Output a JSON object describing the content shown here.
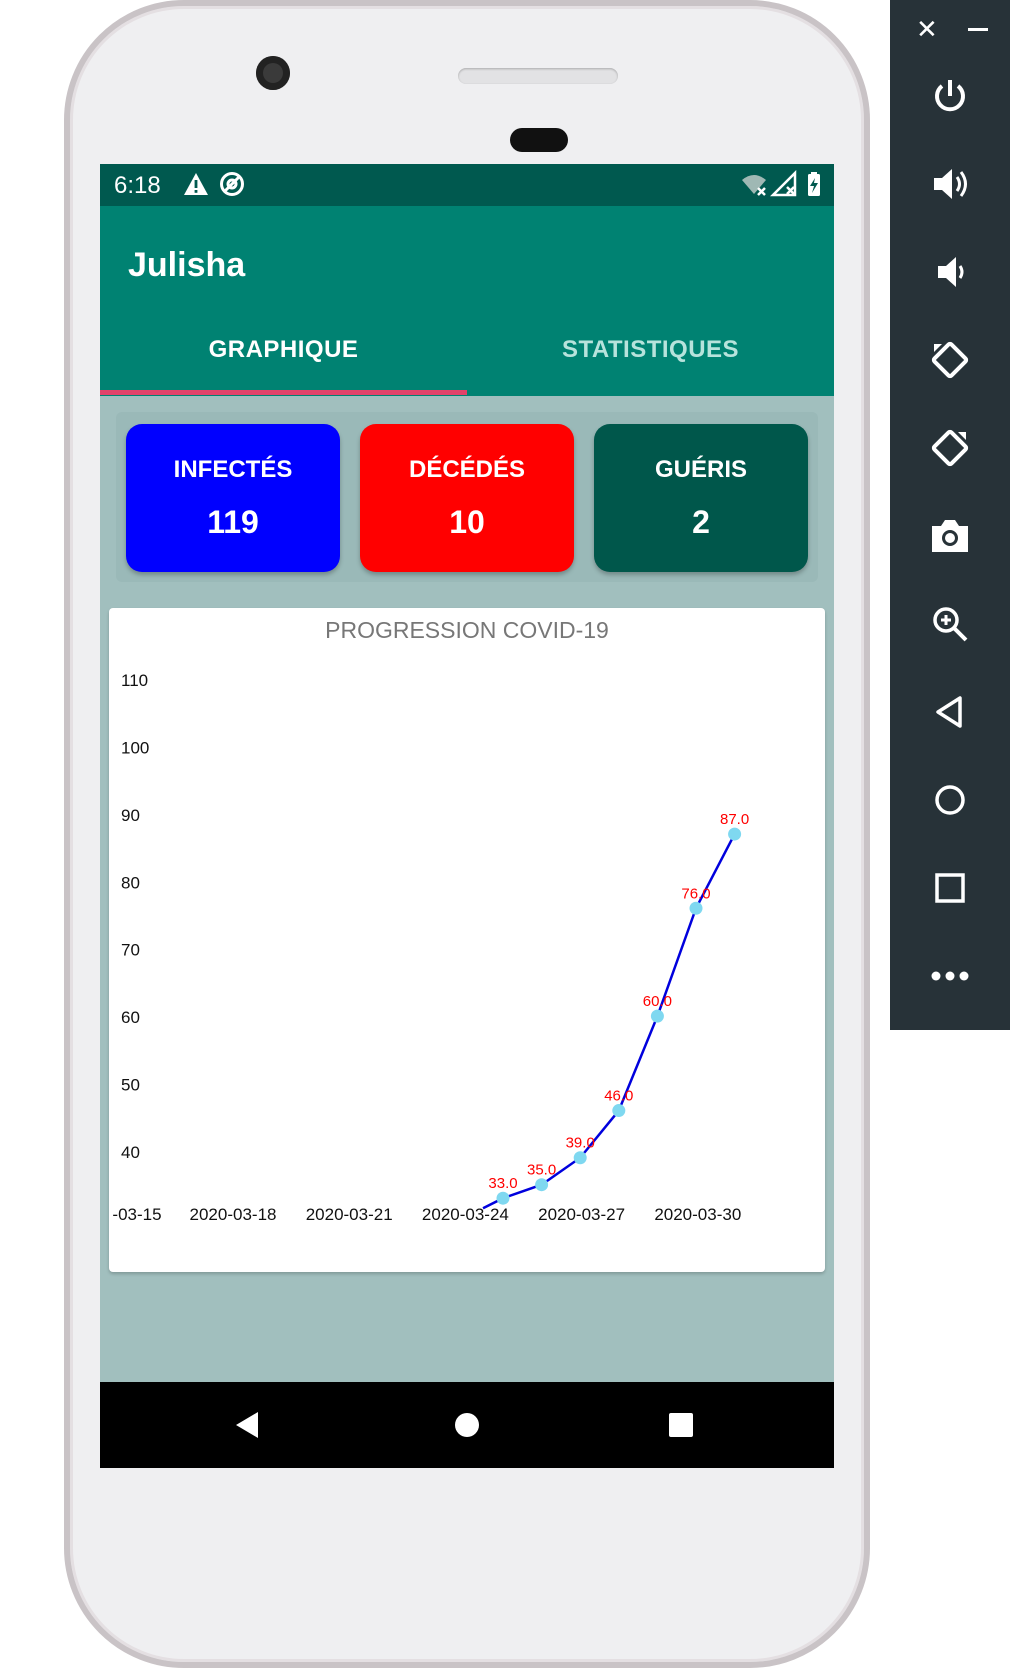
{
  "status_bar": {
    "time": "6:18",
    "left_icons": [
      "warning-icon",
      "accessibility-icon"
    ],
    "right_icons": [
      "wifi-off-icon",
      "signal-off-icon",
      "battery-charging-icon"
    ]
  },
  "app": {
    "title": "Julisha"
  },
  "tabs": [
    {
      "label": "GRAPHIQUE",
      "active": true
    },
    {
      "label": "STATISTIQUES",
      "active": false
    }
  ],
  "colors": {
    "statusbar": "#00594f",
    "appbar": "#008272",
    "tab_indicator": "#e2436a",
    "content_bg": "#a1bfbe",
    "infected": "#0000ff",
    "deaths": "#ff0000",
    "recovered": "#00574b",
    "chart_line": "#0000dd",
    "chart_point": "#7fd8f0",
    "chart_value_label": "#ff0000"
  },
  "stats": {
    "infected": {
      "label": "INFECTÉS",
      "value": "119"
    },
    "deaths": {
      "label": "DÉCÉDÉS",
      "value": "10"
    },
    "recovered": {
      "label": "GUÉRIS",
      "value": "2"
    }
  },
  "chart_data": {
    "type": "line",
    "title": "PROGRESSION COVID-19",
    "xlabel": "",
    "ylabel": "",
    "x_tick_labels": [
      "-03-15",
      "2020-03-18",
      "2020-03-21",
      "2020-03-24",
      "2020-03-27",
      "2020-03-30"
    ],
    "y_ticks": [
      40,
      50,
      60,
      70,
      80,
      90,
      100,
      110
    ],
    "ylim": [
      33,
      112
    ],
    "points": [
      {
        "x": "2020-03-24",
        "y": 33.0,
        "label": "33.0"
      },
      {
        "x": "2020-03-25",
        "y": 35.0,
        "label": "35.0"
      },
      {
        "x": "2020-03-26",
        "y": 39.0,
        "label": "39.0"
      },
      {
        "x": "2020-03-27",
        "y": 46.0,
        "label": "46.0"
      },
      {
        "x": "2020-03-28",
        "y": 60.0,
        "label": "60.0"
      },
      {
        "x": "2020-03-29",
        "y": 76.0,
        "label": "76.0"
      },
      {
        "x": "2020-03-30",
        "y": 87.0,
        "label": "87.0"
      }
    ],
    "grid": false,
    "legend": "none"
  },
  "nav": {
    "icons": [
      "back-icon",
      "home-icon",
      "recents-icon"
    ]
  },
  "emulator_panel": {
    "top_icons": [
      "close-icon",
      "minimize-icon"
    ],
    "buttons": [
      "power-icon",
      "volume-up-icon",
      "volume-down-icon",
      "rotate-left-icon",
      "rotate-right-icon",
      "camera-icon",
      "zoom-icon",
      "back-icon",
      "home-icon",
      "overview-icon",
      "more-icon"
    ]
  }
}
